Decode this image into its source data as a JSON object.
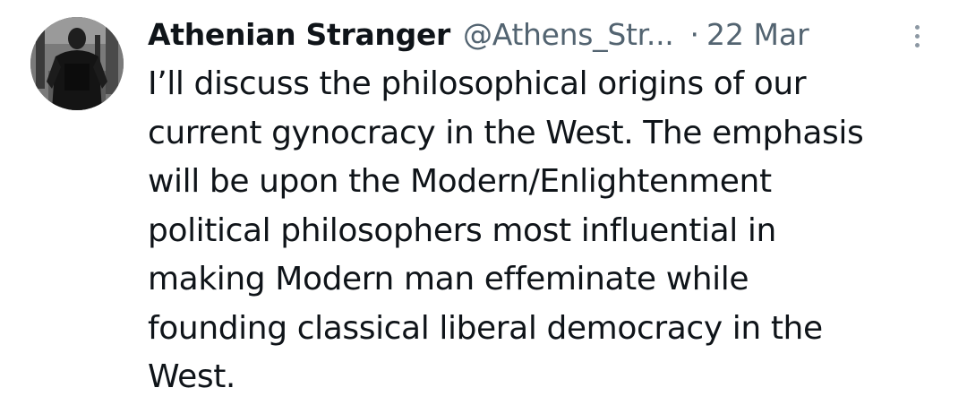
{
  "tweet": {
    "author_name": "Athenian Stranger",
    "author_handle": "@Athens_Str...",
    "separator": "·",
    "timestamp": "22 Mar",
    "more_icon": "more-vertical-icon",
    "avatar": "profile-photo",
    "text_lines": [
      "I’ll discuss the philosophical origins of our",
      "current gynocracy in the West. The emphasis",
      "will be upon the Modern/Enlightenment",
      "political philosophers most influential in",
      "making Modern man effeminate while",
      "founding classical liberal democracy in the",
      "West."
    ]
  }
}
